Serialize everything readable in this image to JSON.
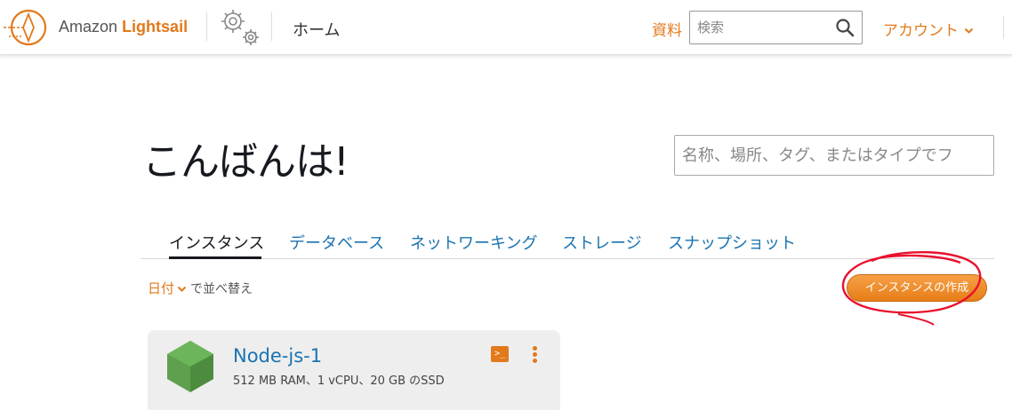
{
  "header": {
    "brand_prefix": "Amazon",
    "brand_name": "Lightsail",
    "home_label": "ホーム",
    "docs_label": "資料",
    "search_placeholder": "検索",
    "account_label": "アカウント"
  },
  "main": {
    "greeting": "こんばんは!",
    "search_placeholder": "名称、場所、タグ、またはタイプでフ",
    "tabs": [
      {
        "label": "インスタンス",
        "active": true
      },
      {
        "label": "データベース",
        "active": false
      },
      {
        "label": "ネットワーキング",
        "active": false
      },
      {
        "label": "ストレージ",
        "active": false
      },
      {
        "label": "スナップショット",
        "active": false
      }
    ],
    "sort": {
      "field": "日付",
      "suffix": "で並べ替え"
    },
    "create_button": "インスタンスの作成"
  },
  "instances": [
    {
      "name": "Node-js-1",
      "spec": "512 MB RAM、1 vCPU、20 GB のSSD",
      "terminal_glyph": ">_"
    }
  ],
  "colors": {
    "accent": "#e2791b",
    "link": "#1a73b0",
    "annotation": "#e8112d"
  },
  "icons": [
    "lightsail-logo-icon",
    "gears-icon",
    "search-icon",
    "chevron-down-icon",
    "nodejs-icon",
    "terminal-icon",
    "kebab-menu-icon"
  ]
}
